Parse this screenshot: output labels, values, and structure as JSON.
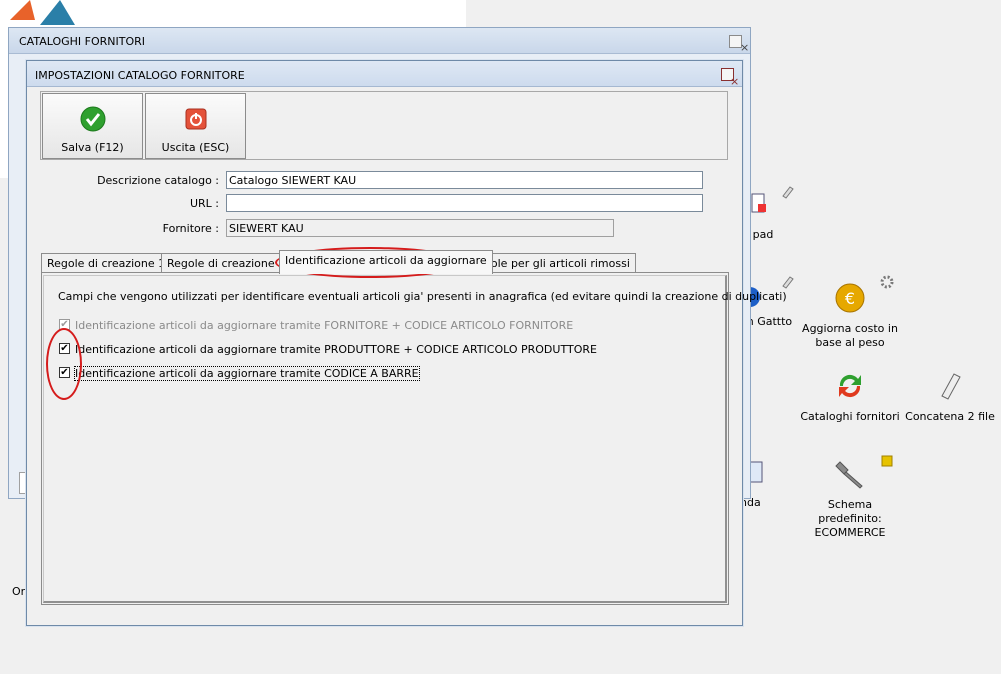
{
  "outer_window": {
    "title": "CATALOGHI FORNITORI",
    "close_glyph": "×"
  },
  "dialog": {
    "title": "IMPOSTAZIONI CATALOGO FORNITORE",
    "close_glyph": "×"
  },
  "toolbar": {
    "save_label": "Salva (F12)",
    "exit_label": "Uscita (ESC)"
  },
  "form": {
    "descrizione_label": "Descrizione catalogo :",
    "descrizione_value": "Catalogo SIEWERT KAU",
    "url_label": "URL :",
    "url_value": "",
    "fornitore_label": "Fornitore :",
    "fornitore_value": "SIEWERT KAU"
  },
  "tabs": [
    {
      "label": "Regole di creazione 1"
    },
    {
      "label": "Regole di creazione 2"
    },
    {
      "label": "Identificazione articoli da aggiornare"
    },
    {
      "label": "Regole per gli articoli rimossi"
    }
  ],
  "panel": {
    "description": "Campi che vengono utilizzati per identificare eventuali articoli gia' presenti in anagrafica (ed evitare quindi la creazione di duplicati)",
    "options": [
      {
        "label": "Identificazione articoli da aggiornare tramite FORNITORE + CODICE ARTICOLO FORNITORE",
        "checked": true,
        "disabled": true
      },
      {
        "label": "Identificazione articoli da aggiornare tramite PRODUTTORE + CODICE ARTICOLO PRODUTTORE",
        "checked": true,
        "disabled": false
      },
      {
        "label": "Identificazione articoli da aggiornare tramite CODICE A BARRE",
        "checked": true,
        "disabled": false
      }
    ]
  },
  "desktop": {
    "pad_label": "pad",
    "gatto_label": "on Gattto",
    "aggiorna_label_1": "Aggiorna costo in",
    "aggiorna_label_2": "base al peso",
    "cataloghi_label": "Cataloghi fornitori",
    "concatena_label": "Concatena 2 file",
    "nda_label": "nda",
    "schema_label_1": "Schema",
    "schema_label_2": "predefinito:",
    "schema_label_3": "ECOMMERCE",
    "ore_label": "Ore"
  },
  "colors": {
    "annotation_red": "#d51c1c",
    "accent_green": "#2fa02f",
    "euro_gold": "#e6a800"
  }
}
